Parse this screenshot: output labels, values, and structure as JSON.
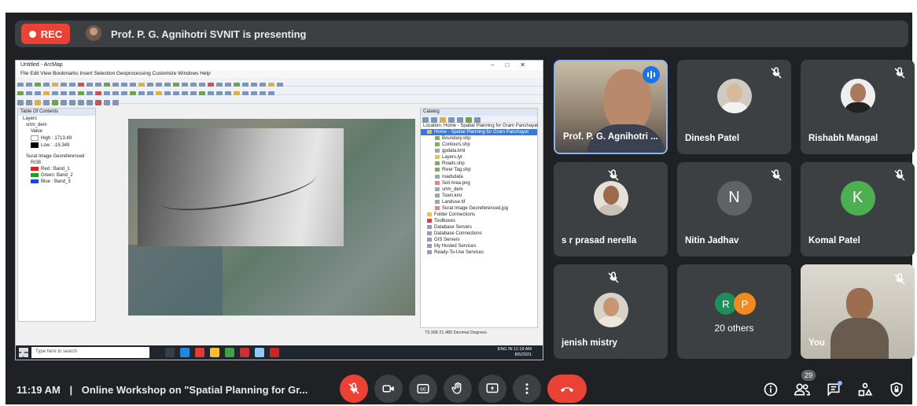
{
  "recording": {
    "label": "REC"
  },
  "presenter_banner": {
    "text": "Prof. P. G. Agnihotri SVNIT is presenting"
  },
  "shared_screen": {
    "window_title": "Untitled - ArcMap",
    "menu": "File  Edit  View  Bookmarks  Insert  Selection  Geoprocessing  Customize  Windows  Help",
    "toc": {
      "title": "Table Of Contents",
      "rows": [
        "Layers",
        "srtm_dem",
        "Value",
        "High : 1713.49",
        "Low : -15.349",
        "Surat Image Georeferenced",
        "RGB",
        "Red : Band_1",
        "Green: Band_2",
        "Blue : Band_3"
      ]
    },
    "catalog": {
      "title": "Catalog",
      "location": "Location: Home - Spatial Planning for Gram Panchayat",
      "rows": [
        "Home - Spatial Planning for Gram Panchayat",
        "Boundary.shp",
        "Contours.shp",
        "gpdata.kml",
        "Layers.lyr",
        "Roads.shp",
        "River Tag.shp",
        "roadsdata",
        "Soil Area.png",
        "srtm_dem",
        "Town.kml",
        "Landuse.tif",
        "Surat Image Georeferenced.jpg",
        "Folder Connections",
        "Toolboxes",
        "Database Servers",
        "Database Connections",
        "GIS Servers",
        "My Hosted Services",
        "Ready-To-Use Services"
      ]
    },
    "status": "73.368 21.485 Decimal Degrees",
    "taskbar": {
      "search_placeholder": "Type here to search",
      "time": "11:19 AM",
      "date": "8/5/2021",
      "lang": "ENG IN"
    }
  },
  "participants": [
    {
      "name": "Prof. P. G. Agnihotri ...",
      "speaking": true
    },
    {
      "name": "Dinesh Patel",
      "muted": true
    },
    {
      "name": "Rishabh Mangal",
      "muted": true
    },
    {
      "name": "s r prasad nerella",
      "muted": true
    },
    {
      "name": "Nitin Jadhav",
      "initial": "N",
      "color": "#5f6368",
      "muted": true
    },
    {
      "name": "Komal Patel",
      "initial": "K",
      "color": "#4caf50",
      "muted": true
    },
    {
      "name": "jenish mistry",
      "muted": true
    },
    {
      "name": "You",
      "muted": true
    }
  ],
  "others": {
    "label": "20 others",
    "initials": [
      "R",
      "P"
    ],
    "colors": [
      "#1e8e5a",
      "#f28b1f"
    ]
  },
  "meeting": {
    "time": "11:19 AM",
    "separator": "|",
    "title": "Online Workshop on \"Spatial Planning for Gr..."
  },
  "people_count": "29",
  "colors": {
    "background": "#202124",
    "tile": "#3c4043",
    "danger": "#ea4335",
    "accent": "#8ab4f8"
  }
}
